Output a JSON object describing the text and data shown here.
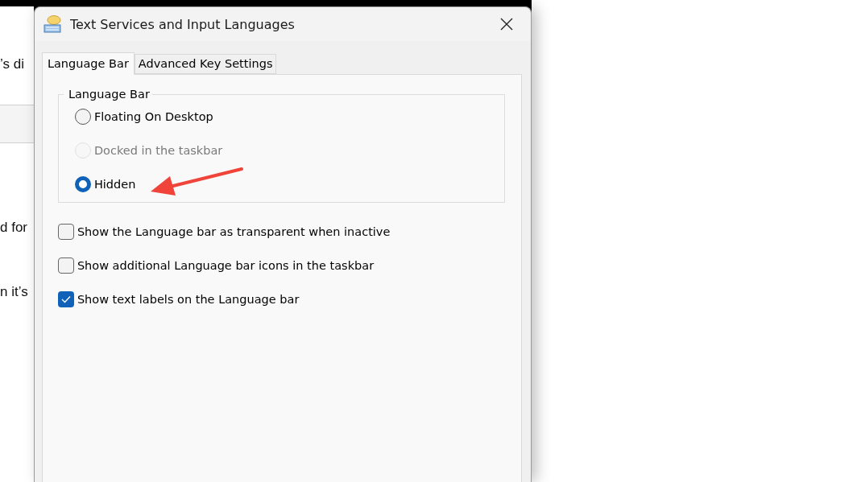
{
  "background_page": {
    "texts": [
      "’s di",
      "d for",
      "n it’s"
    ]
  },
  "window": {
    "title": "Text Services and Input Languages"
  },
  "tabs": [
    {
      "label": "Language Bar",
      "selected": true
    },
    {
      "label": "Advanced Key Settings",
      "selected": false
    }
  ],
  "group": {
    "title": "Language Bar",
    "options": [
      {
        "label": "Floating On Desktop",
        "selected": false,
        "disabled": false
      },
      {
        "label": "Docked in the taskbar",
        "selected": false,
        "disabled": true
      },
      {
        "label": "Hidden",
        "selected": true,
        "disabled": false
      }
    ]
  },
  "checkboxes": [
    {
      "label": "Show the Language bar as transparent when inactive",
      "checked": false
    },
    {
      "label": "Show additional Language bar icons in the taskbar",
      "checked": false
    },
    {
      "label": "Show text labels on the Language bar",
      "checked": true
    }
  ]
}
